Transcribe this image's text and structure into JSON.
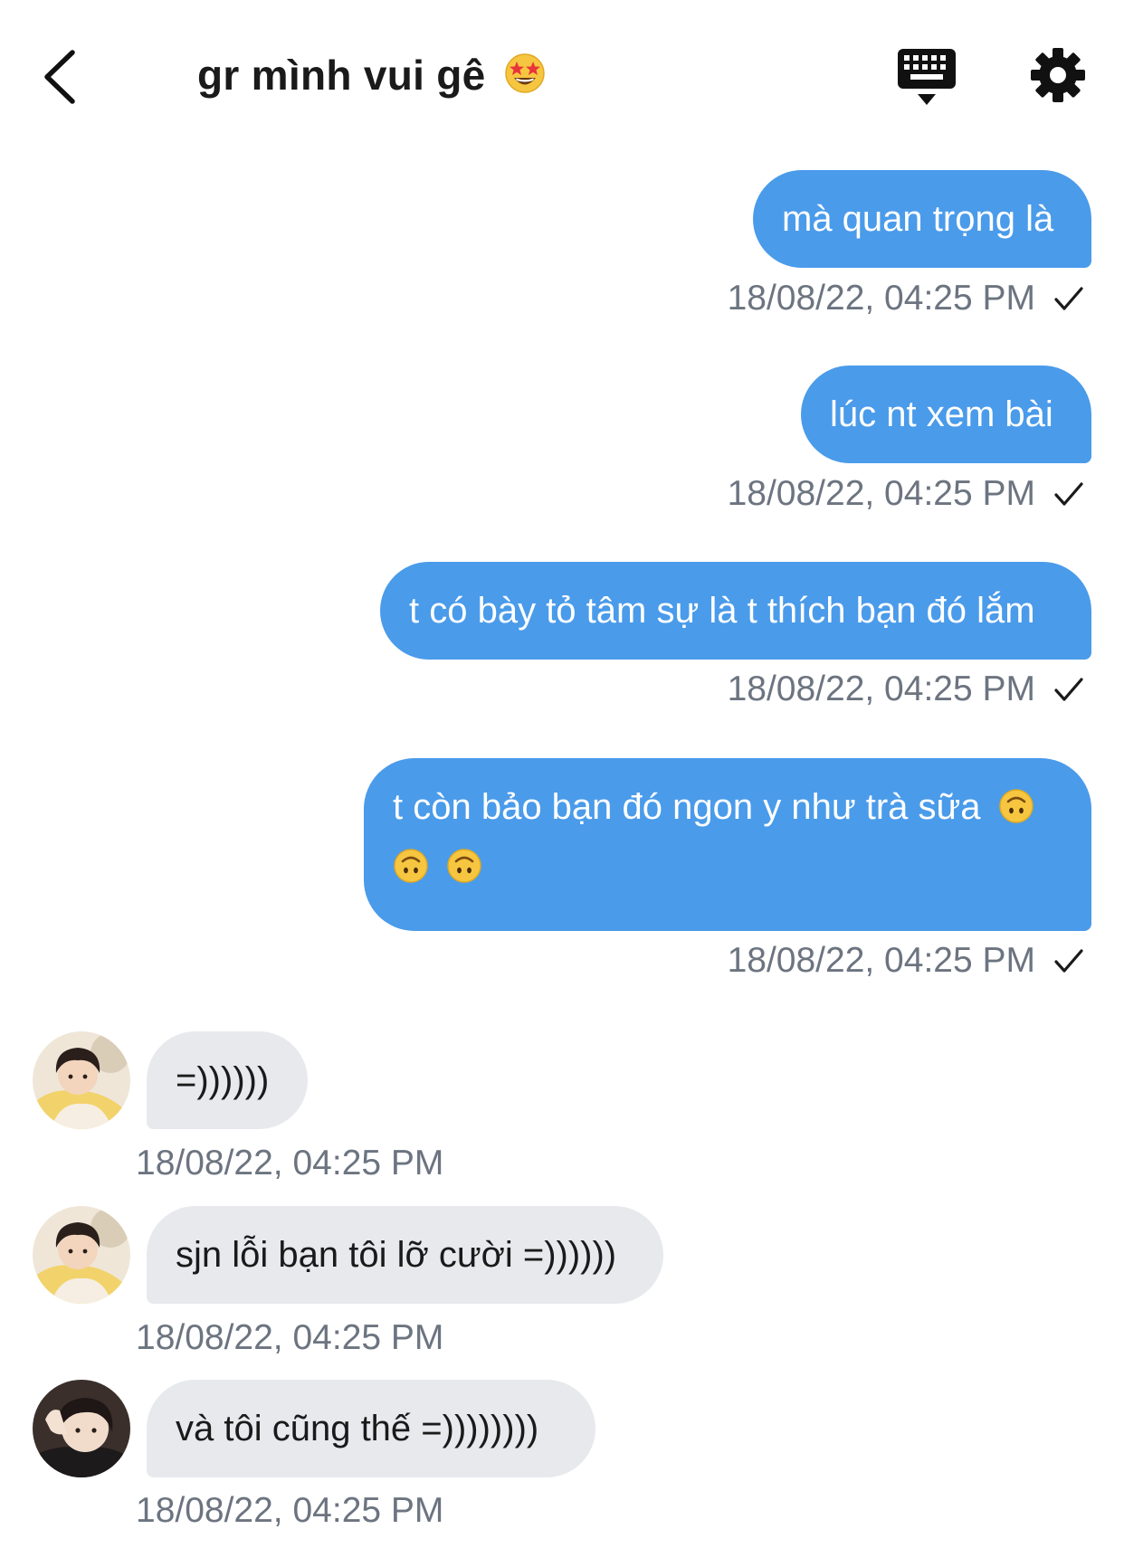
{
  "header": {
    "title": "gr mình vui gê",
    "title_emoji": "star-struck-emoji",
    "back_icon": "chevron-left-icon",
    "keyboard_icon": "keyboard-icon",
    "settings_icon": "gear-icon"
  },
  "colors": {
    "outgoing_bubble": "#4a9bea",
    "incoming_bubble": "#e7e9ed",
    "timestamp": "#6c7480"
  },
  "messages": [
    {
      "direction": "outgoing",
      "text": "mà quan trọng là",
      "time": "18/08/22, 04:25 PM",
      "status": "sent-check-icon"
    },
    {
      "direction": "outgoing",
      "text": "lúc nt xem bài",
      "time": "18/08/22, 04:25 PM",
      "status": "sent-check-icon"
    },
    {
      "direction": "outgoing",
      "text": "t có bày tỏ tâm sự là t thích bạn đó lắm",
      "time": "18/08/22, 04:25 PM",
      "status": "sent-check-icon"
    },
    {
      "direction": "outgoing",
      "text": "t còn bảo bạn đó ngon y như trà sữa",
      "emoji": "upside-down-face-emoji",
      "time": "18/08/22, 04:25 PM",
      "status": "sent-check-icon"
    },
    {
      "direction": "incoming",
      "text": "=))))))",
      "time": "18/08/22, 04:25 PM",
      "avatar": "avatar-1"
    },
    {
      "direction": "incoming",
      "text": "sjn lỗi bạn tôi lỡ cười =))))))",
      "time": "18/08/22, 04:25 PM",
      "avatar": "avatar-1"
    },
    {
      "direction": "incoming",
      "text": "và tôi cũng thế =))))))))",
      "time": "18/08/22, 04:25 PM",
      "avatar": "avatar-2"
    }
  ]
}
